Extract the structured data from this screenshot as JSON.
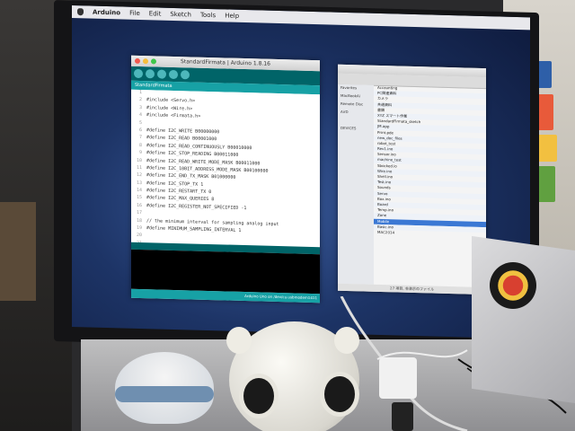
{
  "scene": {
    "description_label": "Monitor showing Arduino IDE and Finder windows on a desk"
  },
  "menubar": {
    "app_name": "Arduino",
    "items": [
      "File",
      "Edit",
      "Sketch",
      "Tools",
      "Help"
    ]
  },
  "arduino": {
    "window_title": "StandardFirmata | Arduino 1.8.16",
    "tab_label": "StandardFirmata",
    "status_text": "Arduino Uno on /dev/cu.usbmodem1411",
    "code_lines": [
      {
        "n": "1",
        "t": ""
      },
      {
        "n": "2",
        "t": "#include <Servo.h>"
      },
      {
        "n": "3",
        "t": "#include <Wire.h>"
      },
      {
        "n": "4",
        "t": "#include <Firmata.h>"
      },
      {
        "n": "5",
        "t": ""
      },
      {
        "n": "6",
        "t": "#define I2C_WRITE                   B00000000"
      },
      {
        "n": "7",
        "t": "#define I2C_READ                    B00001000"
      },
      {
        "n": "8",
        "t": "#define I2C_READ_CONTINUOUSLY       B00010000"
      },
      {
        "n": "9",
        "t": "#define I2C_STOP_READING            B00011000"
      },
      {
        "n": "10",
        "t": "#define I2C_READ_WRITE_MODE_MASK   B00011000"
      },
      {
        "n": "11",
        "t": "#define I2C_10BIT_ADDRESS_MODE_MASK B00100000"
      },
      {
        "n": "12",
        "t": "#define I2C_END_TX_MASK            B01000000"
      },
      {
        "n": "13",
        "t": "#define I2C_STOP_TX                1"
      },
      {
        "n": "14",
        "t": "#define I2C_RESTART_TX             0"
      },
      {
        "n": "15",
        "t": "#define I2C_MAX_QUERIES            8"
      },
      {
        "n": "16",
        "t": "#define I2C_REGISTER_NOT_SPECIFIED  -1"
      },
      {
        "n": "17",
        "t": ""
      },
      {
        "n": "18",
        "t": "// the minimum interval for sampling analog input"
      },
      {
        "n": "19",
        "t": "#define MINIMUM_SAMPLING_INTERVAL   1"
      },
      {
        "n": "20",
        "t": ""
      },
      {
        "n": "21",
        "t": ""
      }
    ]
  },
  "finder": {
    "sidebar": [
      "Favorites",
      "MacBookAi",
      "Remote Disc",
      "AirD",
      "",
      "DEVICES"
    ],
    "rows": [
      "Accounting",
      "PC関連資料",
      "カメラ",
      "共通資料",
      "書類",
      "XYZ スマート作業",
      "StandardFirmata_sketch",
      "JM.app",
      "Print.pde",
      "new_doc_files",
      "robot_test",
      "Rev1.ino",
      "Sensor.ino",
      "machine_test",
      "Sbocked.io",
      "Wire.ino",
      "Shell.ino",
      "Test.ino",
      "Sounds",
      "Servo",
      "Box.ino",
      "Board",
      "Temp.ino",
      "Zone",
      "Mobile",
      "Basic.ino",
      "MAC2014"
    ],
    "status_text": "27 項目, 非表示のファイル"
  }
}
